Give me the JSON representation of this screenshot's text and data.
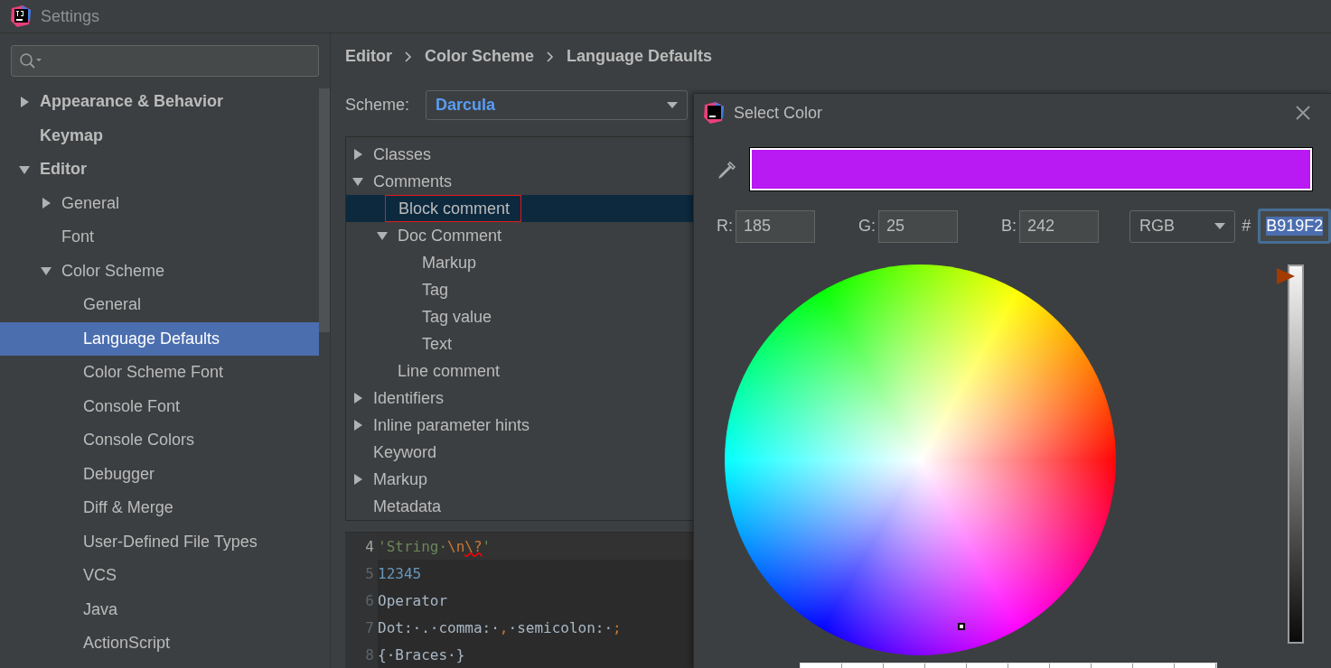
{
  "window": {
    "title": "Settings"
  },
  "sidebar": {
    "items": [
      {
        "label": "Appearance & Behavior",
        "expanded": false,
        "selected": false
      },
      {
        "label": "Keymap",
        "selected": false
      },
      {
        "label": "Editor",
        "expanded": true,
        "selected": false,
        "children": [
          {
            "label": "General",
            "expanded": false,
            "selected": false
          },
          {
            "label": "Font",
            "selected": false
          },
          {
            "label": "Color Scheme",
            "expanded": true,
            "selected": false,
            "children": [
              {
                "label": "General",
                "selected": false
              },
              {
                "label": "Language Defaults",
                "selected": true
              },
              {
                "label": "Color Scheme Font",
                "selected": false
              },
              {
                "label": "Console Font",
                "selected": false
              },
              {
                "label": "Console Colors",
                "selected": false
              },
              {
                "label": "Debugger",
                "selected": false
              },
              {
                "label": "Diff & Merge",
                "selected": false
              },
              {
                "label": "User-Defined File Types",
                "selected": false
              },
              {
                "label": "VCS",
                "selected": false
              },
              {
                "label": "Java",
                "selected": false
              },
              {
                "label": "ActionScript",
                "selected": false
              }
            ]
          }
        ]
      }
    ]
  },
  "breadcrumb": [
    "Editor",
    "Color Scheme",
    "Language Defaults"
  ],
  "scheme": {
    "label": "Scheme:",
    "value": "Darcula"
  },
  "tree": [
    {
      "label": "Classes",
      "expanded": false,
      "selected": false
    },
    {
      "label": "Comments",
      "expanded": true,
      "selected": false,
      "children": [
        {
          "label": "Block comment",
          "selected": true,
          "annotated": true
        },
        {
          "label": "Doc Comment",
          "expanded": true,
          "selected": false,
          "children": [
            {
              "label": "Markup",
              "selected": false
            },
            {
              "label": "Tag",
              "selected": false
            },
            {
              "label": "Tag value",
              "selected": false
            },
            {
              "label": "Text",
              "selected": false
            }
          ]
        },
        {
          "label": "Line comment",
          "selected": false
        }
      ]
    },
    {
      "label": "Identifiers",
      "expanded": false,
      "selected": false
    },
    {
      "label": "Inline parameter hints",
      "expanded": false,
      "selected": false
    },
    {
      "label": "Keyword",
      "selected": false
    },
    {
      "label": "Markup",
      "expanded": false,
      "selected": false
    },
    {
      "label": "Metadata",
      "selected": false
    }
  ],
  "code": [
    {
      "number": "4",
      "current": true,
      "tokens": [
        {
          "kind": "string",
          "text": "'String·"
        },
        {
          "kind": "escape",
          "text": "\\n"
        },
        {
          "kind": "error",
          "text": "\\?"
        },
        {
          "kind": "string",
          "text": "'"
        }
      ]
    },
    {
      "number": "5",
      "current": false,
      "tokens": [
        {
          "kind": "number",
          "text": "12345"
        }
      ]
    },
    {
      "number": "6",
      "current": false,
      "tokens": [
        {
          "kind": "plain",
          "text": "Operator"
        }
      ]
    },
    {
      "number": "7",
      "current": false,
      "tokens": [
        {
          "kind": "plain",
          "text": "Dot:·.·comma:·"
        },
        {
          "kind": "punct",
          "text": ","
        },
        {
          "kind": "plain",
          "text": "·semicolon:·"
        },
        {
          "kind": "punct",
          "text": ";"
        }
      ]
    },
    {
      "number": "8",
      "current": false,
      "tokens": [
        {
          "kind": "plain",
          "text": "{·Braces·}"
        }
      ]
    }
  ],
  "dialog": {
    "title": "Select Color",
    "preview": {
      "color": "#b919f2"
    },
    "channels": [
      {
        "label": "R:",
        "value": "185"
      },
      {
        "label": "G:",
        "value": "25"
      },
      {
        "label": "B:",
        "value": "242"
      }
    ],
    "mode": "RGB",
    "hash_label": "#",
    "hex": "B919F2",
    "brightness": {
      "level": 1
    }
  }
}
